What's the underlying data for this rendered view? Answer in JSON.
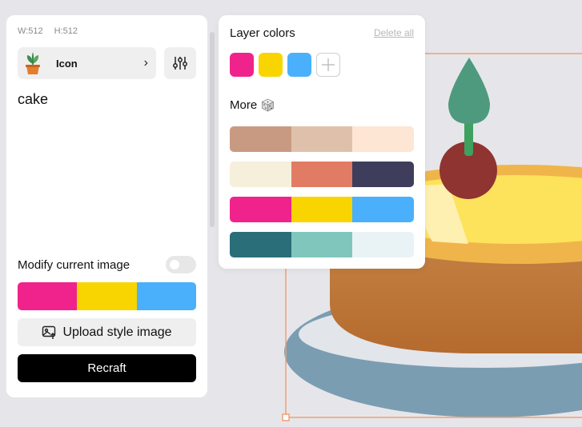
{
  "canvas": {
    "width_label": "W:512",
    "height_label": "H:512"
  },
  "left_panel": {
    "style_type_label": "Icon",
    "prompt": "cake",
    "modify_label": "Modify current image",
    "modify_enabled": false,
    "current_palette": [
      "#f0238c",
      "#f8d500",
      "#4ab0fb"
    ],
    "upload_label": "Upload style image",
    "recraft_label": "Recraft"
  },
  "color_panel": {
    "title": "Layer colors",
    "delete_all_label": "Delete all",
    "layer_colors": [
      "#f0238c",
      "#f8d500",
      "#4ab0fb"
    ],
    "more_label": "More",
    "palettes": [
      [
        "#c99a82",
        "#dfc1ab",
        "#fde6d4"
      ],
      [
        "#f5efdc",
        "#e27b63",
        "#3e3e5c"
      ],
      [
        "#f0238c",
        "#f8d500",
        "#4ab0fb"
      ],
      [
        "#2a6e7a",
        "#81c6bd",
        "#e9f3f5"
      ]
    ]
  },
  "icons": {
    "type_thumb": "potted-plant-icon",
    "chevron": "chevron-right-icon",
    "settings": "sliders-icon",
    "upload": "upload-image-icon",
    "add_color": "plus-icon",
    "more": "dice-icon"
  }
}
